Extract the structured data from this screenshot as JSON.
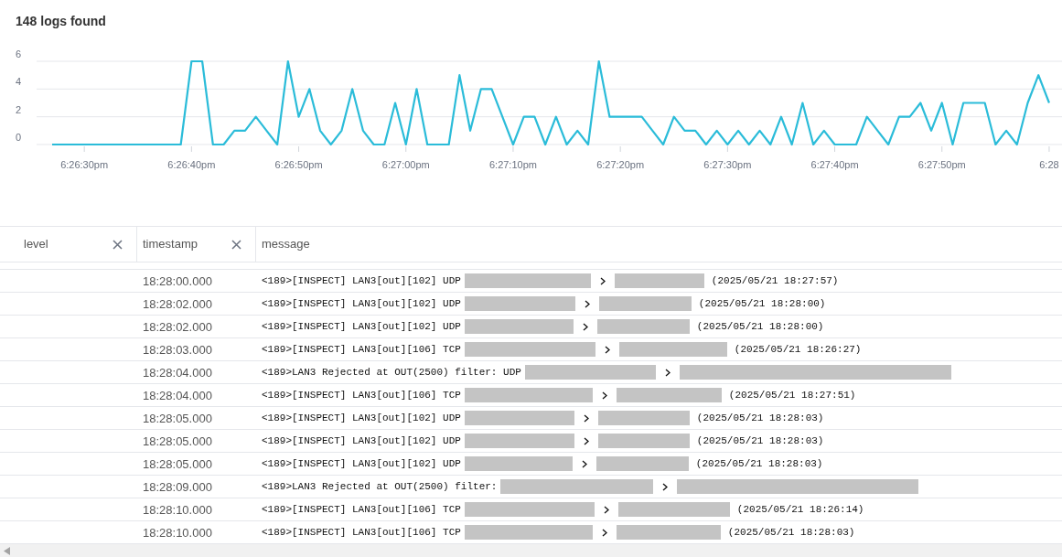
{
  "title": "148 logs found",
  "chart": {
    "chart_data": {
      "type": "line",
      "categories": [
        null,
        null,
        null,
        "6:26:30pm",
        null,
        null,
        null,
        null,
        null,
        null,
        null,
        null,
        null,
        "6:26:40pm",
        null,
        null,
        null,
        null,
        null,
        null,
        null,
        null,
        null,
        "6:26:50pm",
        null,
        null,
        null,
        null,
        null,
        null,
        null,
        null,
        null,
        "6:27:00pm",
        null,
        null,
        null,
        null,
        null,
        null,
        null,
        null,
        null,
        "6:27:10pm",
        null,
        null,
        null,
        null,
        null,
        null,
        null,
        null,
        null,
        "6:27:20pm",
        null,
        null,
        null,
        null,
        null,
        null,
        null,
        null,
        null,
        "6:27:30pm",
        null,
        null,
        null,
        null,
        null,
        null,
        null,
        null,
        null,
        "6:27:40pm",
        null,
        null,
        null,
        null,
        null,
        null,
        null,
        null,
        null,
        "6:27:50pm",
        null,
        null,
        null,
        null,
        null,
        null,
        null,
        null,
        null,
        "6:28"
      ],
      "values": [
        0,
        0,
        0,
        0,
        0,
        0,
        0,
        0,
        0,
        0,
        0,
        0,
        0,
        6,
        6,
        0,
        0,
        1,
        1,
        2,
        1,
        0,
        6,
        2,
        4,
        1,
        0,
        1,
        4,
        1,
        0,
        0,
        3,
        0,
        4,
        0,
        0,
        0,
        5,
        1,
        4,
        4,
        2,
        0,
        2,
        2,
        0,
        2,
        0,
        1,
        0,
        6,
        2,
        2,
        2,
        2,
        1,
        0,
        2,
        1,
        1,
        0,
        1,
        0,
        1,
        0,
        1,
        0,
        2,
        0,
        3,
        0,
        1,
        0,
        0,
        0,
        2,
        1,
        0,
        2,
        2,
        3,
        1,
        3,
        0,
        3,
        3,
        3,
        0,
        1,
        0,
        3,
        5,
        3
      ],
      "ylim": [
        0,
        6
      ],
      "yticks": [
        0,
        2,
        4,
        6
      ]
    }
  },
  "table": {
    "columns": [
      {
        "label": "level",
        "removable": true
      },
      {
        "label": "timestamp",
        "removable": true
      },
      {
        "label": "message",
        "removable": false
      }
    ],
    "rows": [
      {
        "timestamp": "18:28:00.000",
        "message_prefix": "<189>[INSPECT] LAN3[out][102] UDP",
        "message_suffix": "(2025/05/21 18:27:57)"
      },
      {
        "timestamp": "18:28:02.000",
        "message_prefix": "<189>[INSPECT] LAN3[out][102] UDP",
        "message_suffix": "(2025/05/21 18:28:00)"
      },
      {
        "timestamp": "18:28:02.000",
        "message_prefix": "<189>[INSPECT] LAN3[out][102] UDP",
        "message_suffix": "(2025/05/21 18:28:00)"
      },
      {
        "timestamp": "18:28:03.000",
        "message_prefix": "<189>[INSPECT] LAN3[out][106] TCP",
        "message_suffix": "(2025/05/21 18:26:27)"
      },
      {
        "timestamp": "18:28:04.000",
        "message_prefix": "<189>LAN3 Rejected at OUT(2500) filter: UDP"
      },
      {
        "timestamp": "18:28:04.000",
        "message_prefix": "<189>[INSPECT] LAN3[out][106] TCP",
        "message_suffix": "(2025/05/21 18:27:51)"
      },
      {
        "timestamp": "18:28:05.000",
        "message_prefix": "<189>[INSPECT] LAN3[out][102] UDP",
        "message_suffix": "(2025/05/21 18:28:03)"
      },
      {
        "timestamp": "18:28:05.000",
        "message_prefix": "<189>[INSPECT] LAN3[out][102] UDP",
        "message_suffix": "(2025/05/21 18:28:03)"
      },
      {
        "timestamp": "18:28:05.000",
        "message_prefix": "<189>[INSPECT] LAN3[out][102] UDP",
        "message_suffix": "(2025/05/21 18:28:03)"
      },
      {
        "timestamp": "18:28:09.000",
        "message_prefix": "<189>LAN3 Rejected at OUT(2500) filter:"
      },
      {
        "timestamp": "18:28:10.000",
        "message_prefix": "<189>[INSPECT] LAN3[out][106] TCP",
        "message_suffix": "(2025/05/21 18:26:14)"
      },
      {
        "timestamp": "18:28:10.000",
        "message_prefix": "<189>[INSPECT] LAN3[out][106] TCP",
        "message_suffix": "(2025/05/21 18:28:03)"
      }
    ]
  }
}
